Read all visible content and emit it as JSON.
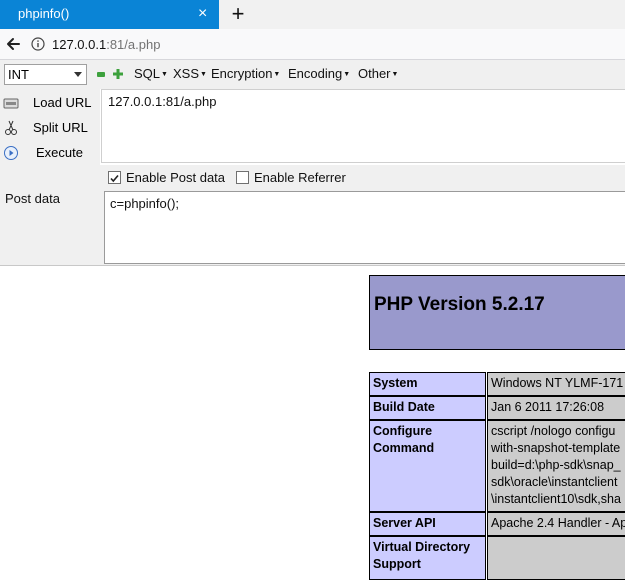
{
  "browser": {
    "tab_title": "phpinfo()",
    "tab_close": "×",
    "new_tab": "+",
    "url_host": "127.0.0.1",
    "url_rest": ":81/a.php"
  },
  "hackbar": {
    "select_value": "INT",
    "menus": [
      "SQL",
      "XSS",
      "Encryption",
      "Encoding",
      "Other"
    ],
    "load_url": "Load URL",
    "split_url": "Split URL",
    "execute": "Execute",
    "url_value": "127.0.0.1:81/a.php",
    "enable_post_label": "Enable Post data",
    "enable_post_checked": true,
    "enable_referrer_label": "Enable Referrer",
    "enable_referrer_checked": false,
    "post_label": "Post data",
    "post_value": "c=phpinfo();"
  },
  "phpinfo": {
    "version_title": "PHP Version 5.2.17",
    "rows": [
      {
        "key": "System",
        "value": [
          "Windows NT YLMF-171"
        ]
      },
      {
        "key": "Build Date",
        "value": [
          "Jan 6 2011 17:26:08"
        ]
      },
      {
        "key": "Configure Command",
        "value": [
          "cscript /nologo configu",
          "with-snapshot-template",
          "build=d:\\php-sdk\\snap_",
          "sdk\\oracle\\instantclient",
          "\\instantclient10\\sdk,sha"
        ]
      },
      {
        "key": "Server API",
        "value": [
          "Apache 2.4 Handler - Ap"
        ]
      },
      {
        "key": "Virtual Directory Support",
        "value": [
          ""
        ]
      }
    ]
  },
  "colors": {
    "tab_blue": "#0a84d6",
    "php_header": "#9999cc",
    "php_key": "#ccccff",
    "php_val": "#cccccc"
  }
}
